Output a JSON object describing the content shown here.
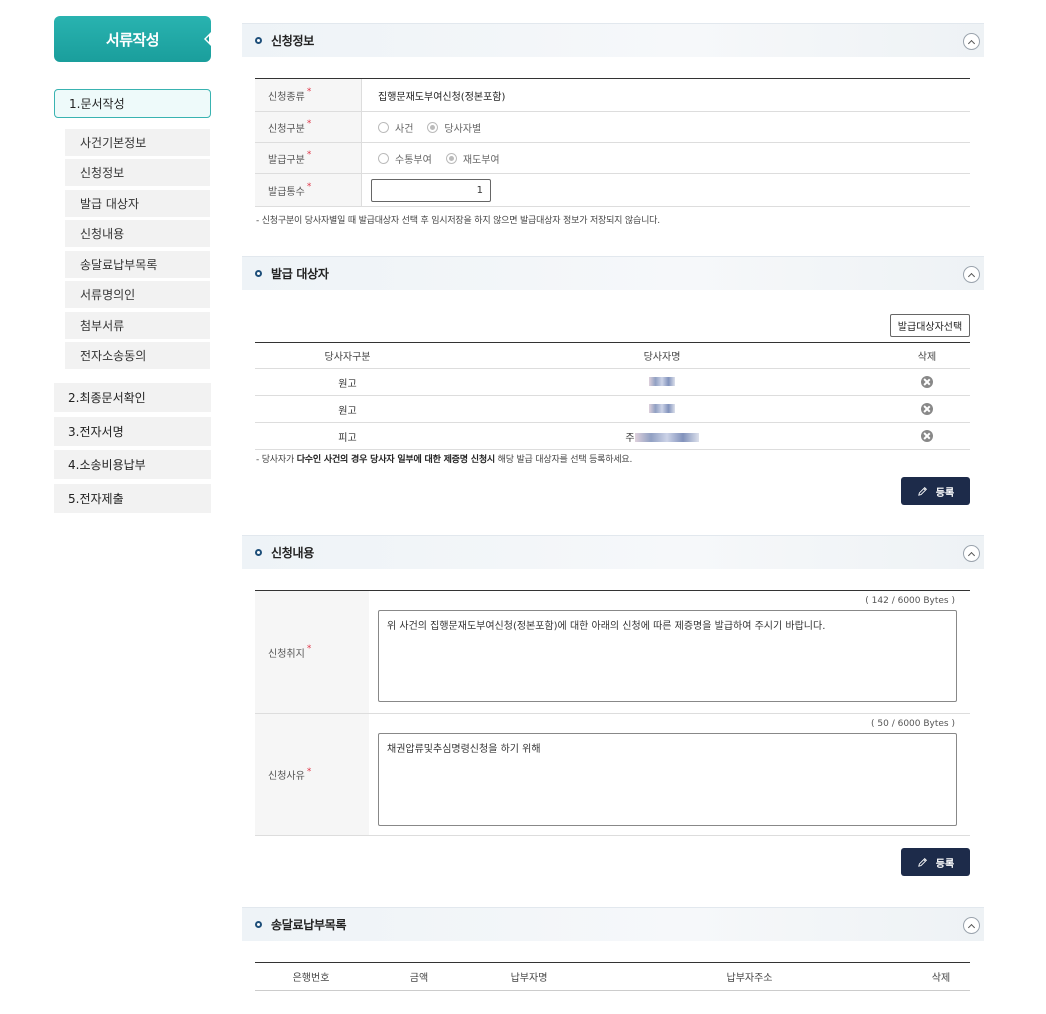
{
  "sidebar": {
    "title": "서류작성",
    "step1": "1.문서작성",
    "sub_items": [
      "사건기본정보",
      "신청정보",
      "발급 대상자",
      "신청내용",
      "송달료납부목록",
      "서류명의인",
      "첨부서류",
      "전자소송동의"
    ],
    "step2": "2.최종문서확인",
    "step3": "3.전자서명",
    "step4": "4.소송비용납부",
    "step5": "5.전자제출"
  },
  "app_info": {
    "title": "신청정보",
    "rows": {
      "type_label": "신청종류",
      "type_value": "집행문재도부여신청(정본포함)",
      "gubun_label": "신청구분",
      "gubun_opt1": "사건",
      "gubun_opt2": "당사자별",
      "issue_label": "발급구분",
      "issue_opt1": "수통부여",
      "issue_opt2": "재도부여",
      "count_label": "발급통수",
      "count_value": "1"
    },
    "note": "- 신청구분이 당사자별일 때 발급대상자 선택 후 임시저장을 하지 않으면 발급대상자 정보가 저장되지 않습니다."
  },
  "targets": {
    "title": "발급 대상자",
    "select_button": "발급대상자선택",
    "columns": [
      "당사자구분",
      "당사자명",
      "삭제"
    ],
    "rows": [
      {
        "type": "원고",
        "name": ""
      },
      {
        "type": "원고",
        "name": ""
      },
      {
        "type": "피고",
        "name": "주"
      }
    ],
    "note_prefix": "- 당사자가 ",
    "note_bold": "다수인 사건의 경우 당사자 일부에 대한 제증명 신청시",
    "note_suffix": " 해당 발급 대상자를 선택 등록하세요.",
    "register_button": "등록"
  },
  "contents": {
    "title": "신청내용",
    "purpose_label": "신청취지",
    "purpose_bytes": "( 142 / 6000 Bytes )",
    "purpose_text": "위 사건의 집행문재도부여신청(정본포함)에 대한 아래의 신청에 따른 제증명을 발급하여 주시기 바랍니다.",
    "reason_label": "신청사유",
    "reason_bytes": "( 50 / 6000 Bytes )",
    "reason_text": "채권압류및추심명령신청을 하기 위해",
    "register_button": "등록"
  },
  "postage": {
    "title": "송달료납부목록",
    "columns": [
      "은행번호",
      "금액",
      "납부자명",
      "납부자주소",
      "삭제"
    ]
  },
  "required_mark": "*"
}
